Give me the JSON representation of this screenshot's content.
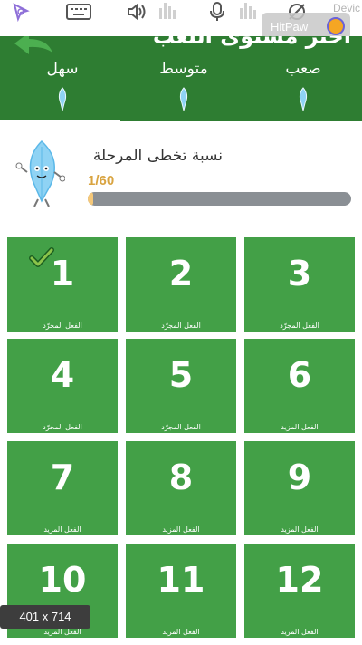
{
  "toolbar": {
    "icons": [
      "cursor-icon",
      "keyboard-icon",
      "speaker-icon",
      "level-bars-icon",
      "microphone-icon",
      "level-bars-icon",
      "no-camera-icon"
    ],
    "recorder_label": "HitPaw",
    "device_label": "Devic"
  },
  "header": {
    "title": "اختر مستوى اللعب",
    "tabs": [
      {
        "label": "سهل",
        "selected": true
      },
      {
        "label": "متوسط",
        "selected": false
      },
      {
        "label": "صعب",
        "selected": false
      }
    ],
    "colors": {
      "background": "#2e7d32",
      "underline": "#ffffff"
    }
  },
  "progress": {
    "title": "نسبة تخطى المرحلة",
    "count": "1/60",
    "fraction": 0.0167,
    "colors": {
      "fill": "#f5c879",
      "track": "#8a8f94",
      "text": "#d9a441"
    }
  },
  "levels": [
    {
      "number": "1",
      "label": "الفعل المجرّد",
      "completed": true
    },
    {
      "number": "2",
      "label": "الفعل المجرّد",
      "completed": false
    },
    {
      "number": "3",
      "label": "الفعل المجرّد",
      "completed": false
    },
    {
      "number": "4",
      "label": "الفعل المجرّد",
      "completed": false
    },
    {
      "number": "5",
      "label": "الفعل المجرّد",
      "completed": false
    },
    {
      "number": "6",
      "label": "الفعل المزيد",
      "completed": false
    },
    {
      "number": "7",
      "label": "الفعل المزيد",
      "completed": false
    },
    {
      "number": "8",
      "label": "الفعل المزيد",
      "completed": false
    },
    {
      "number": "9",
      "label": "الفعل المزيد",
      "completed": false
    },
    {
      "number": "10",
      "label": "الفعل المزيد",
      "completed": false
    },
    {
      "number": "11",
      "label": "الفعل المزيد",
      "completed": false
    },
    {
      "number": "12",
      "label": "الفعل المزيد",
      "completed": false
    }
  ],
  "tile_color": "#43a047",
  "size_badge": "401 x 714"
}
